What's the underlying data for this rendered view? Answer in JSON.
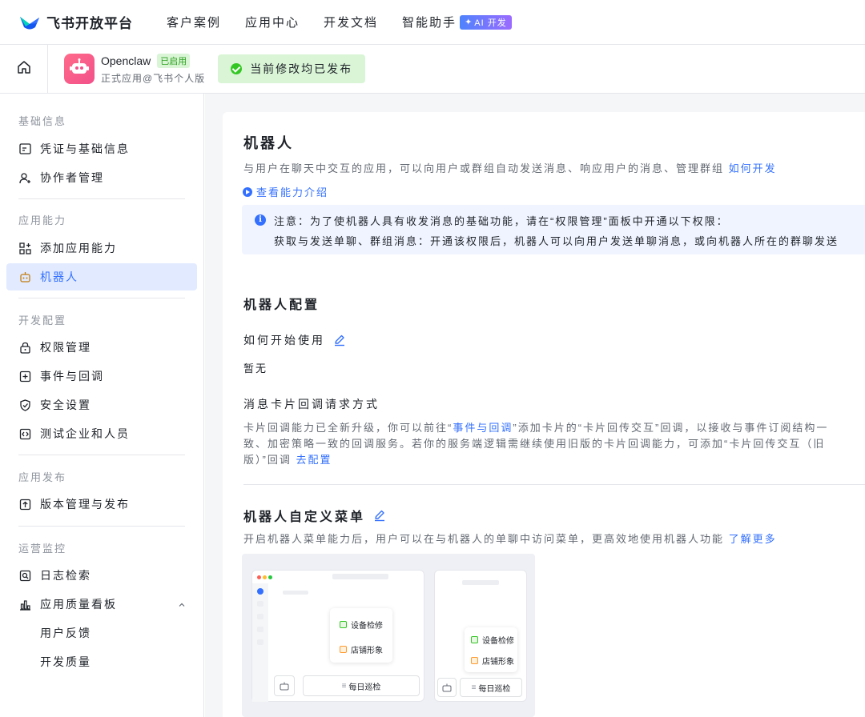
{
  "topnav": {
    "logo_text": "飞书开放平台",
    "links": [
      "客户案例",
      "应用中心",
      "开发文档",
      "智能助手"
    ],
    "ai_badge": "AI 开发"
  },
  "appbar": {
    "app_name": "Openclaw",
    "app_status": "已启用",
    "app_sub": "正式应用@飞书个人版",
    "publish_status": "当前修改均已发布"
  },
  "sidebar": {
    "groups": [
      {
        "title": "基础信息",
        "items": [
          "凭证与基础信息",
          "协作者管理"
        ]
      },
      {
        "title": "应用能力",
        "items": [
          "添加应用能力",
          "机器人"
        ]
      },
      {
        "title": "开发配置",
        "items": [
          "权限管理",
          "事件与回调",
          "安全设置",
          "测试企业和人员"
        ]
      },
      {
        "title": "应用发布",
        "items": [
          "版本管理与发布"
        ]
      },
      {
        "title": "运营监控",
        "items": [
          "日志检索",
          "应用质量看板",
          "用户反馈",
          "开发质量"
        ]
      }
    ]
  },
  "main": {
    "title": "机器人",
    "desc": "与用户在聊天中交互的应用，可以向用户或群组自动发送消息、响应用户的消息、管理群组",
    "desc_link": "如何开发",
    "intro_link": "查看能力介绍",
    "notice_line1": "注意：为了使机器人具有收发消息的基础功能，请在“权限管理”面板中开通以下权限：",
    "notice_line2": "获取与发送单聊、群组消息：开通该权限后，机器人可以向用户发送单聊消息，或向机器人所在的群聊发送",
    "config_title": "机器人配置",
    "howto_title": "如何开始使用",
    "howto_value": "暂无",
    "card_title": "消息卡片回调请求方式",
    "card_text_1": "卡片回调能力已全新升级，你可以前往“",
    "card_text_link1": "事件与回调",
    "card_text_2": "”添加卡片的“卡片回传交互”回调，以接收与事件订阅结构一致、加密策略一致的回调服务。若你的服务端逻辑需继续使用旧版的卡片回调能力，可添加“卡片回传交互（旧版）”回调",
    "card_text_link2": "去配置",
    "menu_title": "机器人自定义菜单",
    "menu_desc": "开启机器人菜单能力后，用户可以在与机器人的单聊中访问菜单，更高效地使用机器人功能",
    "menu_link": "了解更多"
  },
  "illustration": {
    "menu_items": [
      "设备检修",
      "店铺形象"
    ],
    "bottom_label": "每日巡检"
  },
  "colors": {
    "accent": "#3370ff",
    "success": "#34c724",
    "active_bg": "#e1eaff"
  }
}
